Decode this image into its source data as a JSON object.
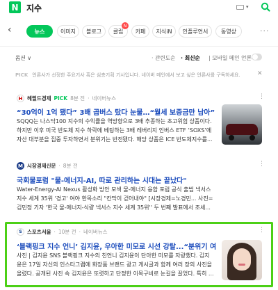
{
  "header": {
    "logo": "N",
    "query": "지수"
  },
  "tabs": [
    {
      "label": "뉴스",
      "active": true
    },
    {
      "label": "이미지"
    },
    {
      "label": "블로그"
    },
    {
      "label": "클립",
      "badge": "N"
    },
    {
      "label": "카페"
    },
    {
      "label": "지식iN"
    },
    {
      "label": "인플루언서"
    },
    {
      "label": "동영상"
    }
  ],
  "options": {
    "label": "옵션 ∨",
    "sort_relevance": "관련도순",
    "sort_latest": "최신순",
    "mobile_only": "모바일 메인 언론사"
  },
  "pick_notice": {
    "tag": "PICK",
    "text": "언론사가 선정한 주요기사 혹은 심층기획 기사입니다. 네이버 메인에서 보고 싶은 언론사를 구독하세요."
  },
  "articles": [
    {
      "source": "헤럴드경제",
      "pick": "PICK",
      "time": "8분 전",
      "naver": "네이버뉴스",
      "title": "“30억이 1억 됐다” 3배 곱버스 탔다 눈물…“월세 보증금만 남아”",
      "body1": "SQQQ는 나스닥100 지수의 수익률을 역방향으로 3배 추종하는 초고위험 상품이다.",
      "body2": "하지만 이후 미국 반도체 지수 하락에 베팅하는 3배 레버리지 인버스 ETF ‘SOXS’에",
      "body3": "자산 대부분을 집중 투자하면서 분위기는 반전됐다. 해당 상품은 ICE 반도체지수를..."
    },
    {
      "source": "시장경제신문",
      "time": "8분 전",
      "title": "국회물포럼 \"물-에너지-AI, 따로 관리하는 시대는 끝났다\"",
      "body1": "Water-Energy-AI Nexus 활성화 방안 모색 물-에너지 융합 포럼 공식 출범 넥서스",
      "body2": "지수 세계 35위 '경고' 여야 한목소리 \"칸막이 걷어내야\" [시장경제=노경민... 사진=",
      "body3": "김민정 기자 '한국 물-에너지-식량 넥서스 지수 세계 35위'' 두 번째 발표에서 조세..."
    },
    {
      "source": "스포츠서울",
      "time": "10분 전",
      "naver": "네이버뉴스",
      "title": "‘블랙핑크 지수 언니’ 김지윤, 우아한 미모로 시선 강탈...“분위기 여...",
      "body1": "사진 | 김지윤 SNS 블랙핑크 지수의 친언니 김지윤이 단아한 미모를 자랑했다. 김지",
      "body2": "윤은 17일 자신의 인스타그램에 화장품 브랜드 광고 게시글과 함께 여러 장의 사진을",
      "body3": "올렸다. 공개된 사진 속 김지윤은 또렷하고 단정한 이목구비로 눈길을 끌었다. 특히 ..."
    }
  ]
}
